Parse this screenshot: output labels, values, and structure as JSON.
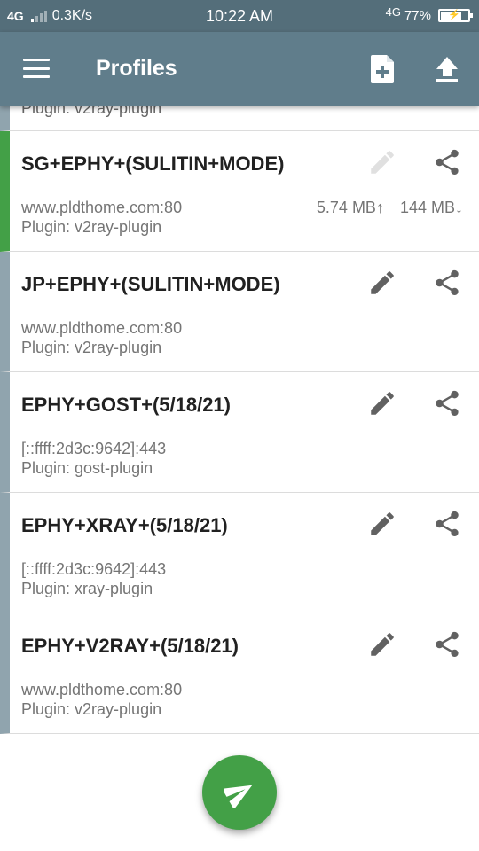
{
  "status_bar": {
    "network_type": "4G",
    "speed": "0.3K/s",
    "time": "10:22 AM",
    "network_type_right": "4G",
    "battery_level": "77%",
    "battery_fraction": 0.77
  },
  "app_bar": {
    "title": "Profiles",
    "icons": [
      "menu-icon",
      "add-file-icon",
      "upload-icon"
    ]
  },
  "partial_item": {
    "text": "Plugin: v2ray-plugin"
  },
  "profiles": [
    {
      "name": "SG+EPHY+(SULITIN+MODE)",
      "host": "www.pldthome.com:80",
      "plugin": "Plugin: v2ray-plugin",
      "upload": "5.74 MB↑",
      "download": "144 MB↓",
      "active": true,
      "edit_enabled": false
    },
    {
      "name": "JP+EPHY+(SULITIN+MODE)",
      "host": "www.pldthome.com:80",
      "plugin": "Plugin: v2ray-plugin",
      "upload": "",
      "download": "",
      "active": false,
      "edit_enabled": true
    },
    {
      "name": "EPHY+GOST+(5/18/21)",
      "host": "[::ffff:2d3c:9642]:443",
      "plugin": "Plugin: gost-plugin",
      "upload": "",
      "download": "",
      "active": false,
      "edit_enabled": true
    },
    {
      "name": "EPHY+XRAY+(5/18/21)",
      "host": "[::ffff:2d3c:9642]:443",
      "plugin": "Plugin: xray-plugin",
      "upload": "",
      "download": "",
      "active": false,
      "edit_enabled": true
    },
    {
      "name": "EPHY+V2RAY+(5/18/21)",
      "host": "www.pldthome.com:80",
      "plugin": "Plugin: v2ray-plugin",
      "upload": "",
      "download": "",
      "active": false,
      "edit_enabled": true
    }
  ],
  "colors": {
    "app_bar": "#607d8b",
    "status_bar": "#546e7a",
    "active_indicator": "#43a047",
    "inactive_indicator": "#90a4ae",
    "fab": "#43a047"
  },
  "fab": {
    "icon": "send-icon"
  }
}
